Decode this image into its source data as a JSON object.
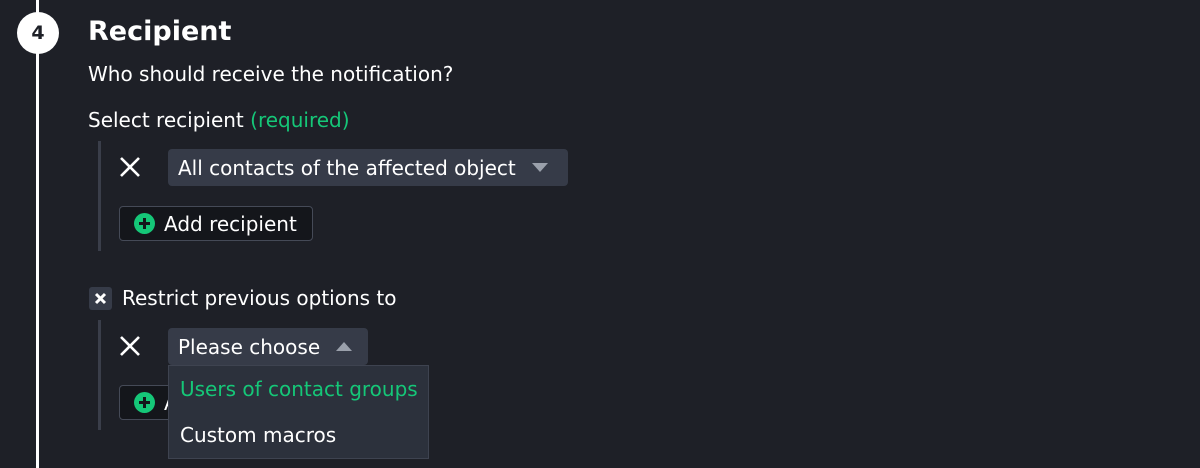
{
  "step": {
    "number": "4",
    "title": "Recipient",
    "subtitle": "Who should receive the notification?"
  },
  "recipient": {
    "label": "Select recipient",
    "required": "(required)",
    "selected": "All contacts of the affected object",
    "add_label": "Add recipient"
  },
  "restrict": {
    "checked": true,
    "label": "Restrict previous options to",
    "selected": "Please choose",
    "add_label": "A",
    "options": [
      "Users of contact groups",
      "Custom macros"
    ],
    "highlighted": "Users of contact groups"
  },
  "colors": {
    "background": "#1e2027",
    "accent": "#15c778",
    "dropdown": "#363b48",
    "menu": "#2c313c"
  },
  "icons": {
    "remove": "close-icon",
    "dropdown_closed": "triangle-down-icon",
    "dropdown_open": "triangle-up-icon",
    "add": "plus-circle-icon",
    "checkbox": "checkmark-x-icon"
  }
}
